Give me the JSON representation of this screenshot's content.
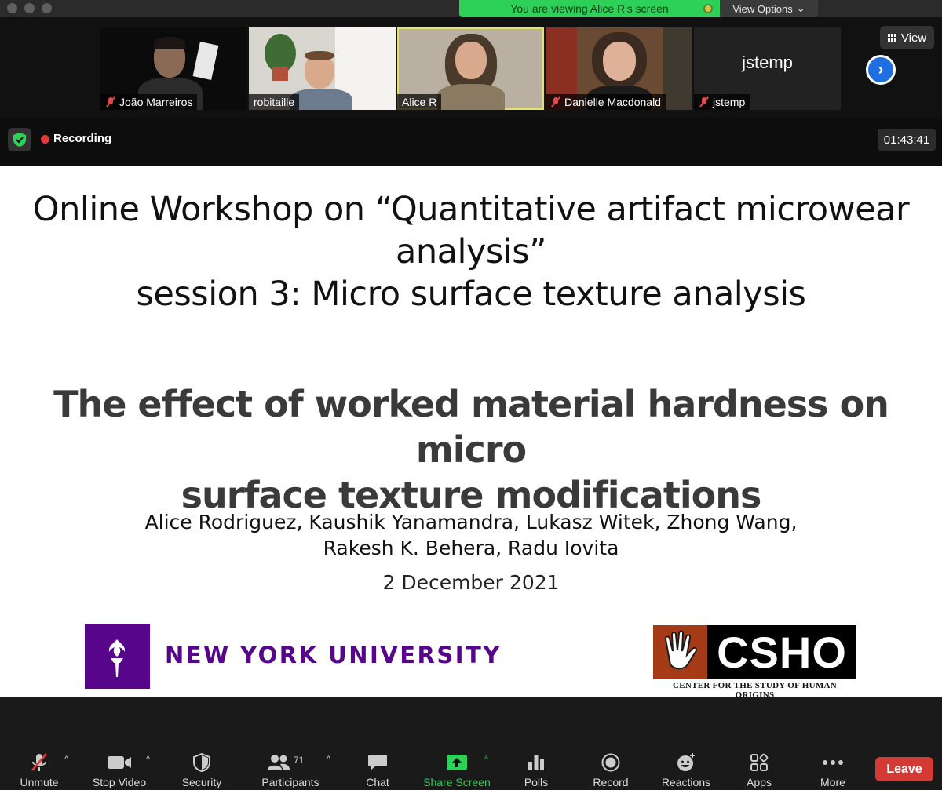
{
  "titlebar": {
    "banner_text": "You are viewing Alice R's screen",
    "view_options": "View Options"
  },
  "gallery": {
    "view_label": "View",
    "participants": [
      {
        "name": "João Marreiros",
        "muted": true
      },
      {
        "name": "robitaille",
        "muted": false
      },
      {
        "name": "Alice R",
        "muted": false,
        "active": true
      },
      {
        "name": "Danielle Macdonald",
        "muted": true
      },
      {
        "name": "jstemp",
        "muted": true,
        "avatar_text": "jstemp"
      }
    ]
  },
  "recording": {
    "label": "Recording",
    "timer": "01:43:41"
  },
  "slide": {
    "title_line1": "Online Workshop on “Quantitative artifact microwear",
    "title_line2": "analysis”",
    "title_line3": "session 3: Micro surface texture analysis",
    "heading_line1": "The effect of worked material hardness on micro",
    "heading_line2": "surface texture modifications",
    "authors_line1": "Alice Rodriguez, Kaushik Yanamandra, Lukasz Witek, Zhong Wang,",
    "authors_line2": "Rakesh K. Behera, Radu Iovita",
    "date": "2 December 2021",
    "nyu_logo_text": "NEW YORK UNIVERSITY",
    "csho_logo_text": "CSHO",
    "csho_subtitle": "CENTER FOR THE STUDY OF HUMAN ORIGINS"
  },
  "toolbar": {
    "unmute": "Unmute",
    "stop_video": "Stop Video",
    "security": "Security",
    "participants": "Participants",
    "participants_count": "71",
    "chat": "Chat",
    "share_screen": "Share Screen",
    "polls": "Polls",
    "record": "Record",
    "reactions": "Reactions",
    "apps": "Apps",
    "more": "More",
    "leave": "Leave"
  },
  "colors": {
    "banner_green": "#2ed158",
    "active_tile_border": "#e9e06b",
    "nyu_purple": "#57068c",
    "leave_red": "#d43a35",
    "recording_red": "#e23a3a"
  }
}
